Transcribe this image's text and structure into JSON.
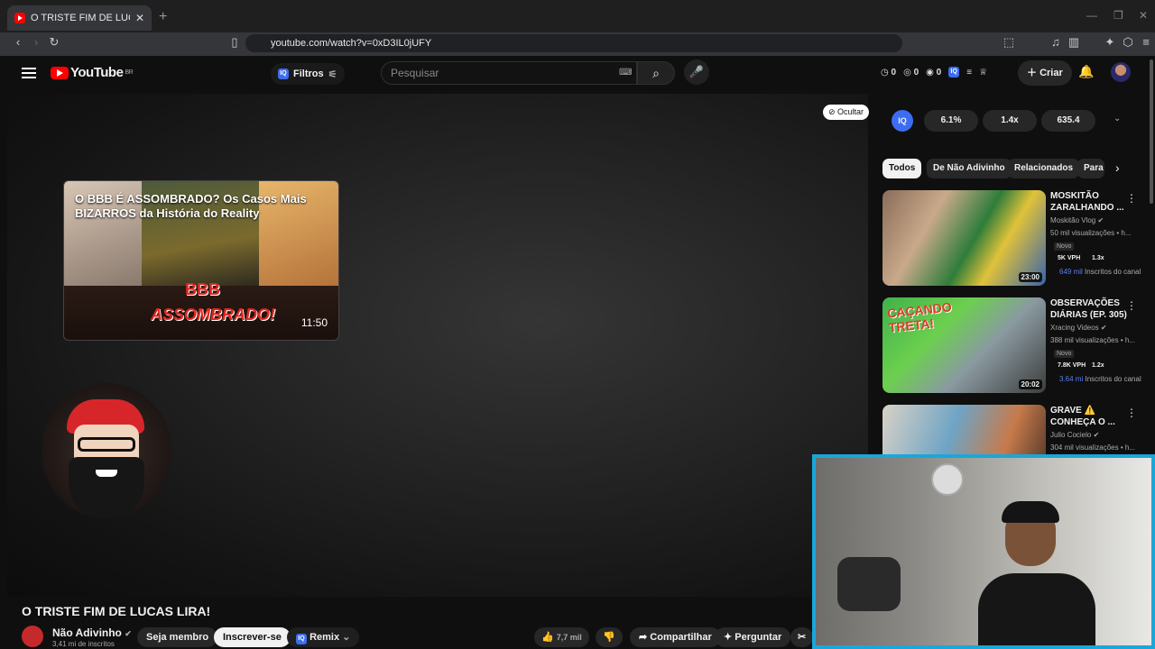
{
  "browser": {
    "tab_title": "O TRISTE FIM DE LUCAS LIRA! - YouTube",
    "url": "youtube.com/watch?v=0xD3IL0jUFY",
    "new_tab": "+",
    "close": "✕"
  },
  "header": {
    "logo": "YouTube",
    "region": "BR",
    "filtros": "Filtros",
    "search_placeholder": "Pesquisar",
    "stat1": "0",
    "stat2": "0",
    "stat3": "0",
    "criar": "Criar"
  },
  "player": {
    "ocultar": "Ocultar",
    "endcard_title": "O BBB É ASSOMBRADO? Os Casos Mais BIZARROS da História do Reality",
    "endcard_bbb": "BBB",
    "endcard_assombrado": "ASSOMBRADO!",
    "endcard_duration": "11:50"
  },
  "video": {
    "title": "O TRISTE FIM DE LUCAS LIRA!",
    "channel": "Não Adivinho",
    "subscribers": "3,41 mi de inscritos",
    "seja_membro": "Seja membro",
    "inscrever": "Inscrever-se",
    "remix": "Remix",
    "likes": "7,7 mil",
    "compartilhar": "Compartilhar",
    "perguntar": "Perguntar"
  },
  "sidebar": {
    "iq": "IQ",
    "metrics": [
      "6.1%",
      "1.4x",
      "635.4"
    ],
    "chips": [
      "Todos",
      "De Não Adivinho",
      "Relacionados",
      "Para"
    ],
    "recs": [
      {
        "title": "MOSKITÃO ZARALHANDO ...",
        "channel": "Moskitão Vlog",
        "views": "50 mil visualizações • h...",
        "badge": "Novo",
        "vph": "5K VPH",
        "mult": "1.3x",
        "subs_count": "649 mil",
        "subs_label": "Inscritos do canal",
        "duration": "23:00"
      },
      {
        "title": "OBSERVAÇÕES DIÁRIAS (EP. 305)",
        "channel": "Xracing Videos",
        "views": "388 mil visualizações • h...",
        "badge": "Novo",
        "vph": "7.8K VPH",
        "mult": "1.2x",
        "subs_count": "3.64 mi",
        "subs_label": "Inscritos do canal",
        "duration": "20:02"
      },
      {
        "title": "GRAVE ⚠️ CONHEÇA O ...",
        "channel": "Julio Cocielo",
        "views": "304 mil visualizações • h..."
      }
    ]
  },
  "colors": {
    "accent": "#ff0000",
    "webcam_border": "#1aa7d9",
    "iq_blue": "#3c6df0"
  }
}
